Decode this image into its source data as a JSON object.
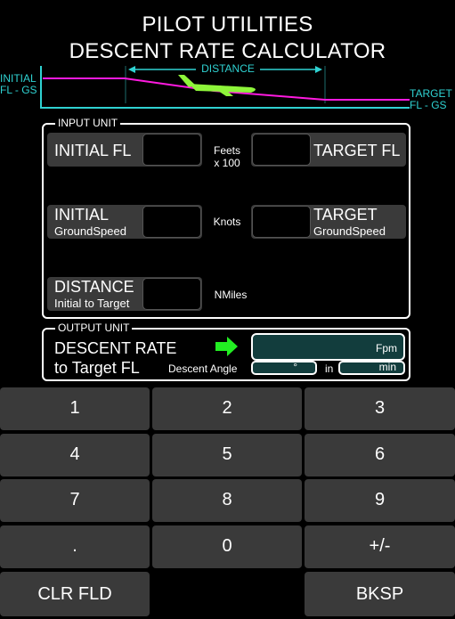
{
  "header": {
    "title_line1": "PILOT UTILITIES",
    "title_line2": "DESCENT RATE CALCULATOR"
  },
  "diagram": {
    "initial_label_line1": "INITIAL",
    "initial_label_line2": "FL - GS",
    "distance_label": "DISTANCE",
    "target_label_line1": "TARGET",
    "target_label_line2": "FL - GS"
  },
  "input_unit": {
    "legend": "INPUT UNIT",
    "initial_fl": {
      "label": "INITIAL FL",
      "value": ""
    },
    "target_fl": {
      "label": "TARGET FL",
      "value": ""
    },
    "fl_unit_line1": "Feets",
    "fl_unit_line2": "x 100",
    "initial_gs": {
      "label": "INITIAL",
      "sublabel": "GroundSpeed",
      "value": ""
    },
    "target_gs": {
      "label": "TARGET",
      "sublabel": "GroundSpeed",
      "value": ""
    },
    "gs_unit": "Knots",
    "distance": {
      "label": "DISTANCE",
      "sublabel": "Initial to Target",
      "value": ""
    },
    "distance_unit": "NMiles"
  },
  "output_unit": {
    "legend": "OUTPUT UNIT",
    "label_line1": "DESCENT RATE",
    "label_line2": "to Target FL",
    "rate_unit": "Fpm",
    "angle_label": "Descent Angle",
    "angle_unit": "°",
    "in_label": "in",
    "time_unit": "min"
  },
  "keypad": {
    "k1": "1",
    "k2": "2",
    "k3": "3",
    "k4": "4",
    "k5": "5",
    "k6": "6",
    "k7": "7",
    "k8": "8",
    "k9": "9",
    "kdot": ".",
    "k0": "0",
    "ksign": "+/-",
    "clr": "CLR FLD",
    "bksp": "BKSP"
  },
  "colors": {
    "teal": "#2fd2d2",
    "magenta": "#ff1adf",
    "plane": "#8ef53a",
    "arrow": "#22ee22",
    "output_fill": "#123d3d"
  }
}
